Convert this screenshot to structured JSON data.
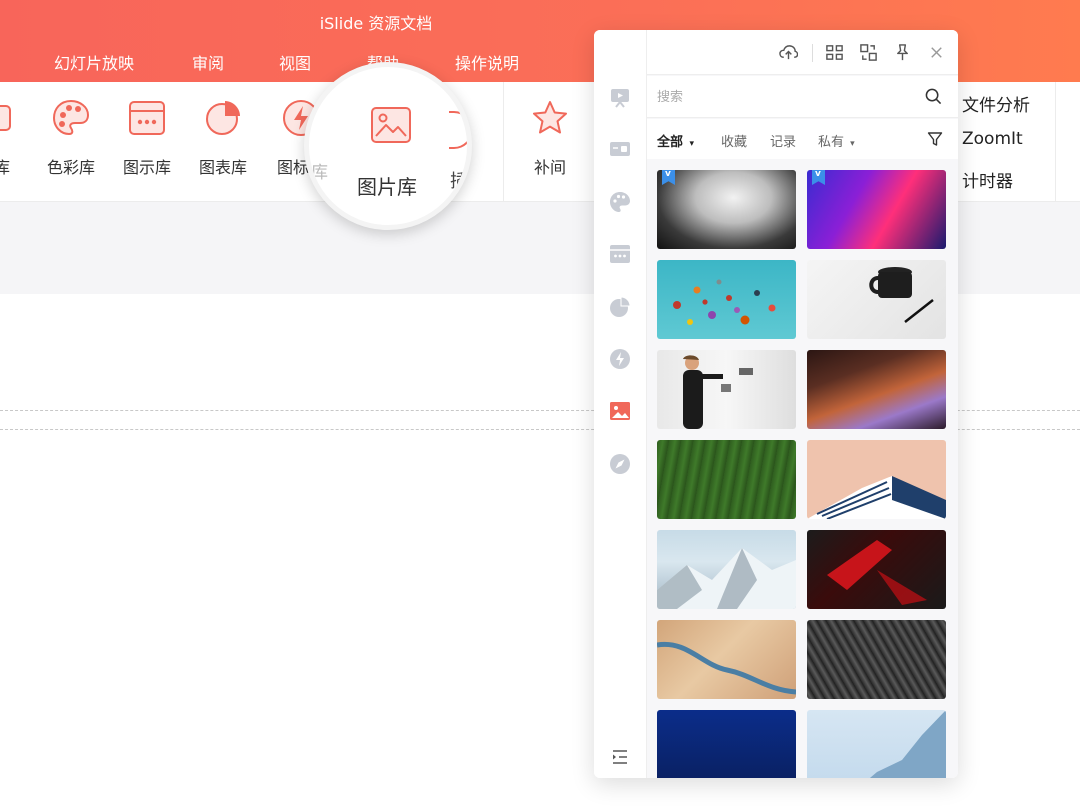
{
  "app": {
    "title": "iSlide 资源文档"
  },
  "menu": [
    "幻灯片放映",
    "审阅",
    "视图",
    "帮助",
    "操作说明"
  ],
  "ribbon": {
    "items": [
      "题库",
      "色彩库",
      "图示库",
      "图表库",
      "图标库",
      "补间"
    ],
    "right_items": [
      "文件分析",
      "ZoomIt",
      "计时器"
    ]
  },
  "magnifier": {
    "label": "图片库",
    "partial_left": "库",
    "partial_right": "插"
  },
  "panel": {
    "search_placeholder": "搜索",
    "filters": [
      "全部",
      "收藏",
      "记录",
      "私有"
    ],
    "thumbnails": [
      "architecture-bw",
      "abstract-gradient",
      "hot-air-balloons",
      "coffee-cup-pen",
      "man-drawing-on-wall",
      "canyon-waves",
      "green-leaf",
      "buildings-pink-sky",
      "snowy-mountains",
      "red-light-dark",
      "desert-river",
      "dark-rock-texture",
      "deep-blue-water",
      "ice-glacier"
    ]
  },
  "colors": {
    "accent": "#f0685a",
    "title_bar": "#f8655a",
    "badge": "#3b8fe8"
  }
}
